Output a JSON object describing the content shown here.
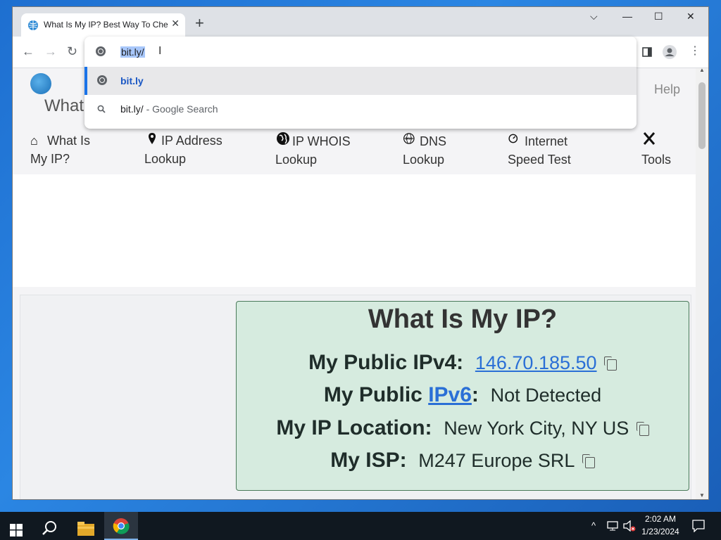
{
  "browser": {
    "tab_title": "What Is My IP? Best Way To Check",
    "tab_close": "✕",
    "new_tab": "+",
    "window_controls": {
      "tab_search": "⌵",
      "minimize": "—",
      "maximize": "☐",
      "close": "✕"
    },
    "toolbar": {
      "back": "←",
      "forward": "→",
      "reload": "↻"
    }
  },
  "omnibox": {
    "input_value": "bit.ly/",
    "suggestions": [
      {
        "text": "bit.ly",
        "sub": ""
      },
      {
        "text": "bit.ly/",
        "sub": " - Google Search"
      }
    ]
  },
  "site": {
    "title": "WhatI",
    "help": "Help",
    "nav": [
      {
        "label_1": "What Is",
        "label_2": "My IP?",
        "icon": "home-icon"
      },
      {
        "label_1": "IP Address",
        "label_2": "Lookup",
        "icon": "map-pin-icon"
      },
      {
        "label_1": "IP WHOIS",
        "label_2": "Lookup",
        "icon": "globe-icon"
      },
      {
        "label_1": "DNS",
        "label_2": "Lookup",
        "icon": "dns-icon"
      },
      {
        "label_1": "Internet",
        "label_2": "Speed Test",
        "icon": "speedometer-icon"
      },
      {
        "label_1": "",
        "label_2": "Tools",
        "icon": "tools-icon"
      }
    ]
  },
  "ip_info": {
    "heading": "What Is My IP?",
    "ipv4_label": "My Public IPv4:",
    "ipv4_value": "146.70.185.50",
    "ipv6_label_pre": "My Public ",
    "ipv6_link": "IPv6",
    "ipv6_label_post": ":",
    "ipv6_value": "Not Detected",
    "location_label": "My IP Location:",
    "location_value": "New York City, NY US",
    "isp_label": "My ISP:",
    "isp_value": "M247 Europe SRL"
  },
  "taskbar": {
    "time": "2:02 AM",
    "date": "1/23/2024"
  },
  "colors": {
    "accent": "#1a73e8",
    "ip_box_bg": "#d6ebdf",
    "link": "#2a6fd6"
  }
}
